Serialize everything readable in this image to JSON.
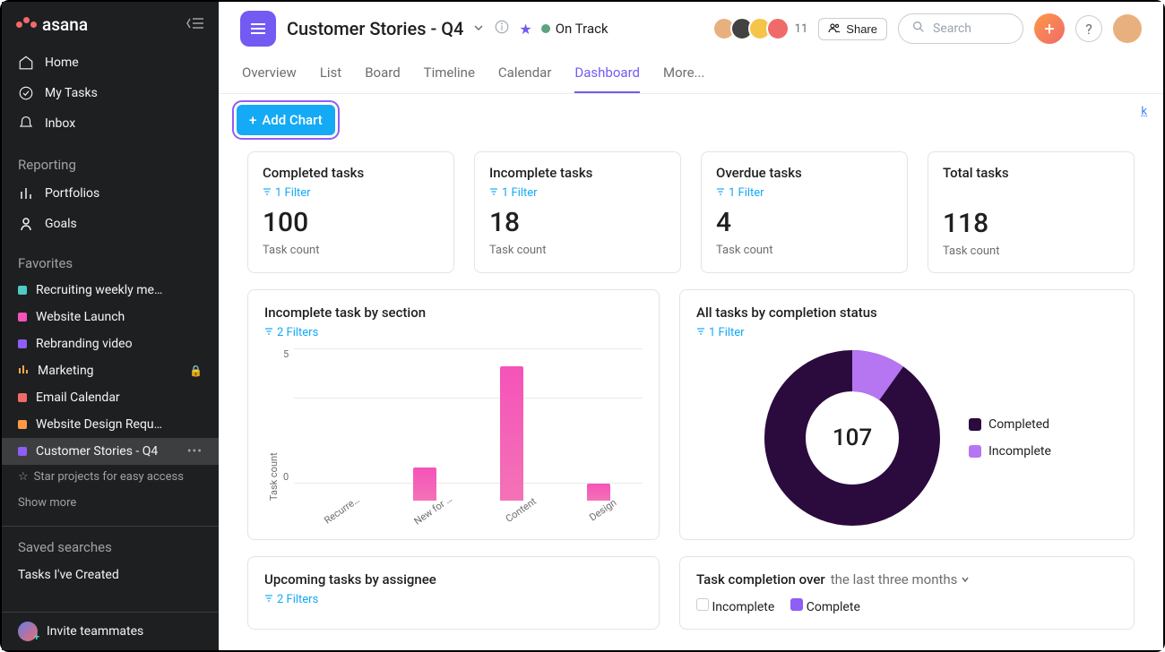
{
  "brand": "asana",
  "sidebar": {
    "nav": {
      "home": "Home",
      "my_tasks": "My Tasks",
      "inbox": "Inbox"
    },
    "reporting_heading": "Reporting",
    "reporting": {
      "portfolios": "Portfolios",
      "goals": "Goals"
    },
    "favorites_heading": "Favorites",
    "favorites": [
      {
        "label": "Recruiting weekly me…",
        "color": "#4ecbc4"
      },
      {
        "label": "Website Launch",
        "color": "#f553b9"
      },
      {
        "label": "Rebranding video",
        "color": "#8e5ef5"
      },
      {
        "label": "Marketing",
        "color": "#f8a94a",
        "locked": true,
        "is_chart_icon": true
      },
      {
        "label": "Email Calendar",
        "color": "#f06a6a"
      },
      {
        "label": "Website Design Requ…",
        "color": "#fc9947"
      },
      {
        "label": "Customer Stories - Q4",
        "color": "#8e5ef5",
        "active": true,
        "more": true
      }
    ],
    "star_tip": "Star projects for easy access",
    "show_more": "Show more",
    "saved_heading": "Saved searches",
    "saved": {
      "tasks_created": "Tasks I've Created"
    },
    "invite": "Invite teammates"
  },
  "header": {
    "title": "Customer Stories - Q4",
    "status": "On Track",
    "member_overflow": "11",
    "share": "Share",
    "search_placeholder": "Search",
    "help": "?",
    "avatar_colors": [
      "#e8b07e",
      "#424242",
      "#f5c449",
      "#f06a6a"
    ]
  },
  "tabs": [
    "Overview",
    "List",
    "Board",
    "Timeline",
    "Calendar",
    "Dashboard",
    "More..."
  ],
  "active_tab": "Dashboard",
  "add_chart_label": "Add Chart",
  "corner_link": "k",
  "stats": [
    {
      "title": "Completed tasks",
      "filter": "1 Filter",
      "value": "100",
      "sub": "Task count"
    },
    {
      "title": "Incomplete tasks",
      "filter": "1 Filter",
      "value": "18",
      "sub": "Task count"
    },
    {
      "title": "Overdue tasks",
      "filter": "1 Filter",
      "value": "4",
      "sub": "Task count"
    },
    {
      "title": "Total tasks",
      "filter": "",
      "value": "118",
      "sub": "Task count"
    }
  ],
  "bar_chart": {
    "title": "Incomplete task by section",
    "filter": "2 Filters",
    "ylabel": "Task count",
    "ticks": [
      "5",
      "0"
    ],
    "categories": [
      "Recurre…",
      "New for …",
      "Content",
      "Design"
    ],
    "values": [
      0,
      2,
      8,
      1
    ],
    "max": 8
  },
  "donut_chart": {
    "title": "All tasks by completion status",
    "filter": "1 Filter",
    "center": "107",
    "legend": [
      {
        "label": "Completed",
        "color": "#2b0a3d"
      },
      {
        "label": "Incomplete",
        "color": "#b676f2"
      }
    ],
    "completed_fraction": 0.88
  },
  "upcoming_card": {
    "title": "Upcoming tasks by assignee",
    "filter": "2 Filters"
  },
  "completion_card": {
    "title": "Task completion over",
    "range": "the last three months",
    "legend_incomplete": "Incomplete",
    "legend_complete": "Complete"
  },
  "chart_data": [
    {
      "type": "bar",
      "title": "Incomplete task by section",
      "ylabel": "Task count",
      "ylim": [
        0,
        8
      ],
      "categories": [
        "Recurring",
        "New for Q4",
        "Content",
        "Design"
      ],
      "values": [
        0,
        2,
        8,
        1
      ]
    },
    {
      "type": "pie",
      "title": "All tasks by completion status",
      "series": [
        {
          "name": "Completed",
          "value": 94
        },
        {
          "name": "Incomplete",
          "value": 13
        }
      ],
      "center_label": 107
    },
    {
      "type": "table",
      "title": "Task summary counts",
      "rows": [
        {
          "label": "Completed tasks",
          "value": 100
        },
        {
          "label": "Incomplete tasks",
          "value": 18
        },
        {
          "label": "Overdue tasks",
          "value": 4
        },
        {
          "label": "Total tasks",
          "value": 118
        }
      ]
    }
  ]
}
